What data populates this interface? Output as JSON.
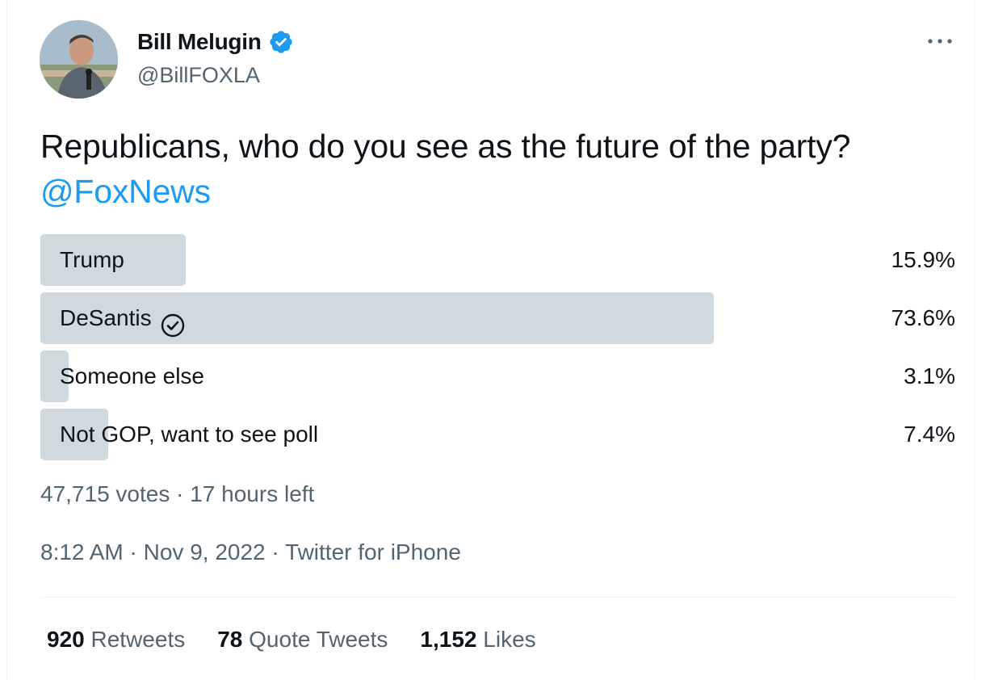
{
  "author": {
    "name": "Bill Melugin",
    "handle": "@BillFOXLA",
    "verified": true
  },
  "tweet": {
    "text": "Republicans, who do you see as the future of the party? ",
    "mention": "@FoxNews"
  },
  "poll": {
    "options": [
      {
        "label": "Trump",
        "percent": "15.9%",
        "value": 15.9,
        "selected": false
      },
      {
        "label": "DeSantis",
        "percent": "73.6%",
        "value": 73.6,
        "selected": true
      },
      {
        "label": "Someone else",
        "percent": "3.1%",
        "value": 3.1,
        "selected": false
      },
      {
        "label": "Not GOP, want to see poll",
        "percent": "7.4%",
        "value": 7.4,
        "selected": false
      }
    ],
    "votes": "47,715 votes",
    "time_left": "17 hours left"
  },
  "meta": {
    "time": "8:12 AM",
    "date": "Nov 9, 2022",
    "source": "Twitter for iPhone"
  },
  "stats": {
    "retweets_count": "920",
    "retweets_label": "Retweets",
    "quotes_count": "78",
    "quotes_label": "Quote Tweets",
    "likes_count": "1,152",
    "likes_label": "Likes"
  },
  "colors": {
    "accent": "#1d9bf0",
    "bar": "#cfd9de",
    "secondary_text": "#536471"
  },
  "icons": [
    "verified-badge-icon",
    "more-options-icon",
    "check-circle-icon"
  ]
}
